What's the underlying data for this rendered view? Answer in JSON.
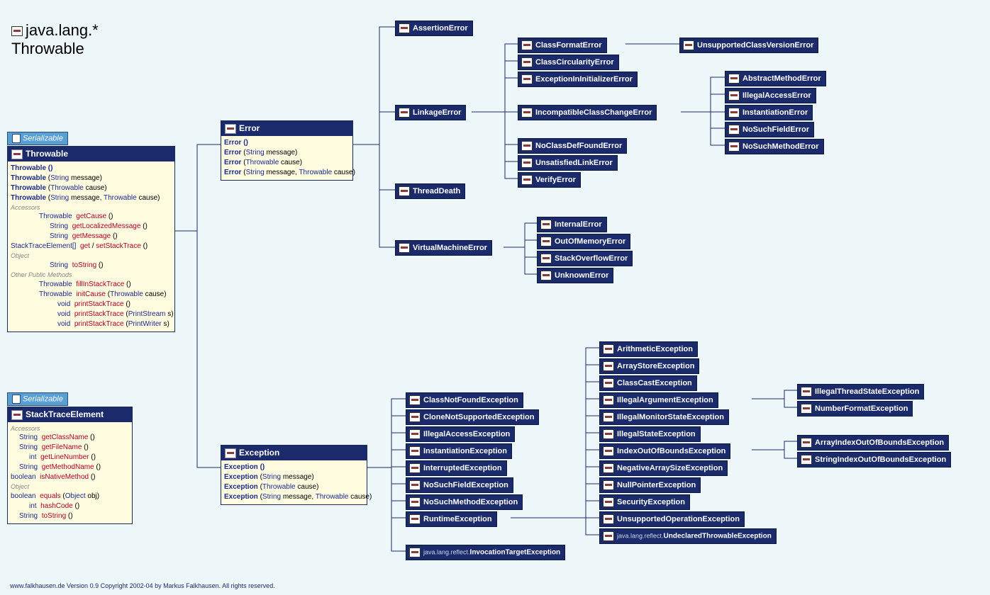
{
  "title": {
    "line1": "java.lang.*",
    "line2": "Throwable"
  },
  "iface": {
    "serializable": "Serializable"
  },
  "throwable": {
    "name": "Throwable",
    "ctors": [
      "Throwable ()",
      "Throwable (String message)",
      "Throwable (Throwable cause)",
      "Throwable (String message, Throwable cause)"
    ],
    "sec1": "Accessors",
    "m1": [
      [
        "Throwable",
        "getCause ()"
      ],
      [
        "String",
        "getLocalizedMessage ()"
      ],
      [
        "String",
        "getMessage ()"
      ],
      [
        "StackTraceElement[]",
        "get / setStackTrace ()"
      ]
    ],
    "sec2": "Object",
    "m2": [
      [
        "String",
        "toString ()"
      ]
    ],
    "sec3": "Other Public Methods",
    "m3": [
      [
        "Throwable",
        "fillInStackTrace ()"
      ],
      [
        "Throwable",
        "initCause (Throwable cause)"
      ],
      [
        "void",
        "printStackTrace ()"
      ],
      [
        "void",
        "printStackTrace (PrintStream s)"
      ],
      [
        "void",
        "printStackTrace (PrintWriter s)"
      ]
    ]
  },
  "ste": {
    "name": "StackTraceElement",
    "sec1": "Accessors",
    "m1": [
      [
        "String",
        "getClassName ()"
      ],
      [
        "String",
        "getFileName ()"
      ],
      [
        "int",
        "getLineNumber ()"
      ],
      [
        "String",
        "getMethodName ()"
      ],
      [
        "boolean",
        "isNativeMethod ()"
      ]
    ],
    "sec2": "Object",
    "m2": [
      [
        "boolean",
        "equals (Object obj)"
      ],
      [
        "int",
        "hashCode ()"
      ],
      [
        "String",
        "toString ()"
      ]
    ]
  },
  "error": {
    "name": "Error",
    "ctors": [
      "Error ()",
      "Error (String message)",
      "Error (Throwable cause)",
      "Error (String message, Throwable cause)"
    ]
  },
  "exception": {
    "name": "Exception",
    "ctors": [
      "Exception ()",
      "Exception (String message)",
      "Exception (Throwable cause)",
      "Exception (String message, Throwable cause)"
    ]
  },
  "errNodes": {
    "assertion": "AssertionError",
    "linkage": "LinkageError",
    "threaddeath": "ThreadDeath",
    "vme": "VirtualMachineError"
  },
  "linkageKids": {
    "cfe": "ClassFormatError",
    "cce": "ClassCircularityError",
    "eii": "ExceptionInInitializerError",
    "icce": "IncompatibleClassChangeError",
    "ncde": "NoClassDefFoundError",
    "ule": "UnsatisfiedLinkError",
    "ve": "VerifyError"
  },
  "cfeKid": {
    "ucve": "UnsupportedClassVersionError"
  },
  "icceKids": {
    "ame": "AbstractMethodError",
    "iae": "IllegalAccessError",
    "ie": "InstantiationError",
    "nsfe": "NoSuchFieldError",
    "nsme": "NoSuchMethodError"
  },
  "vmeKids": {
    "intern": "InternalError",
    "oom": "OutOfMemoryError",
    "sof": "StackOverflowError",
    "unk": "UnknownError"
  },
  "excKids": {
    "cnfe": "ClassNotFoundException",
    "cnse": "CloneNotSupportedException",
    "iae": "IllegalAccessException",
    "ie": "InstantiationException",
    "inte": "InterruptedException",
    "nsfe": "NoSuchFieldException",
    "nsme": "NoSuchMethodException",
    "rte": "RuntimeException",
    "ite_ns": "java.lang.reflect.",
    "ite": "InvocationTargetException"
  },
  "rteKids": {
    "ae": "ArithmeticException",
    "ase": "ArrayStoreException",
    "cce": "ClassCastException",
    "iae": "IllegalArgumentException",
    "imse": "IllegalMonitorStateException",
    "ise": "IllegalStateException",
    "ioobe": "IndexOutOfBoundsException",
    "nase": "NegativeArraySizeException",
    "npe": "NullPointerException",
    "se": "SecurityException",
    "uoe": "UnsupportedOperationException",
    "ute_ns": "java.lang.reflect.",
    "ute": "UndeclaredThrowableException"
  },
  "iaeKids": {
    "itse": "IllegalThreadStateException",
    "nfe": "NumberFormatException"
  },
  "ioobeKids": {
    "aioobe": "ArrayIndexOutOfBoundsException",
    "sioobe": "StringIndexOutOfBoundsException"
  },
  "footer": "www.falkhausen.de Version 0.9 Copyright 2002-04 by Markus Falkhausen. All rights reserved."
}
